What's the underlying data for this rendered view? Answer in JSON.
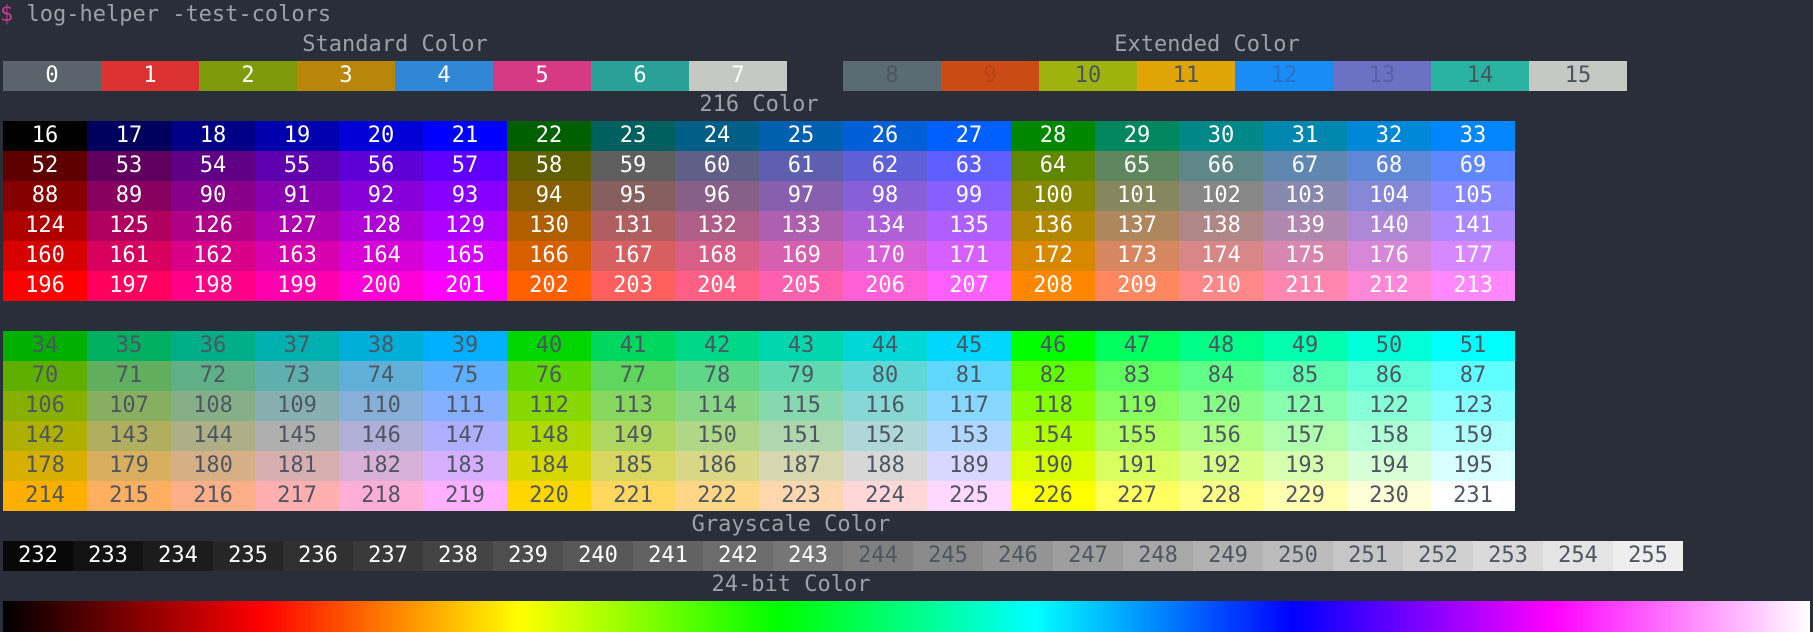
{
  "terminal": {
    "prompt_symbol": "$",
    "command": "log-helper -test-colors"
  },
  "titles": {
    "standard": "Standard Color",
    "extended": "Extended Color",
    "c216": "216 Color",
    "grayscale": "Grayscale Color",
    "truecolor": "24-bit Color"
  },
  "standard_colors": [
    {
      "label": "0",
      "bg": "#5b636c",
      "fg": "#ffffff"
    },
    {
      "label": "1",
      "bg": "#dc3232",
      "fg": "#ffffff"
    },
    {
      "label": "2",
      "bg": "#7f9a0a",
      "fg": "#ffffff"
    },
    {
      "label": "3",
      "bg": "#b8860b",
      "fg": "#ffffff"
    },
    {
      "label": "4",
      "bg": "#2f87d6",
      "fg": "#ffffff"
    },
    {
      "label": "5",
      "bg": "#d63a84",
      "fg": "#ffffff"
    },
    {
      "label": "6",
      "bg": "#2aa198",
      "fg": "#ffffff"
    },
    {
      "label": "7",
      "bg": "#c6c8c3",
      "fg": "#ffffff"
    }
  ],
  "extended_colors": [
    {
      "label": "8",
      "bg": "#5b6b74",
      "fg": "#4a5560"
    },
    {
      "label": "9",
      "bg": "#cb4b16",
      "fg": "#b84514"
    },
    {
      "label": "10",
      "bg": "#9fb30e",
      "fg": "#4a5560"
    },
    {
      "label": "11",
      "bg": "#e0a505",
      "fg": "#4a5560"
    },
    {
      "label": "12",
      "bg": "#1a8cf5",
      "fg": "#2a70c8"
    },
    {
      "label": "13",
      "bg": "#6c71c4",
      "fg": "#5b5fa8"
    },
    {
      "label": "14",
      "bg": "#2ab3a0",
      "fg": "#4a5560"
    },
    {
      "label": "15",
      "bg": "#c6c8c3",
      "fg": "#4a5560"
    }
  ],
  "palette216": {
    "block1_rows": [
      [
        "16",
        "17",
        "18",
        "19",
        "20",
        "21",
        "22",
        "23",
        "24",
        "25",
        "26",
        "27",
        "28",
        "29",
        "30",
        "31",
        "32",
        "33"
      ],
      [
        "52",
        "53",
        "54",
        "55",
        "56",
        "57",
        "58",
        "59",
        "60",
        "61",
        "62",
        "63",
        "64",
        "65",
        "66",
        "67",
        "68",
        "69"
      ],
      [
        "88",
        "89",
        "90",
        "91",
        "92",
        "93",
        "94",
        "95",
        "96",
        "97",
        "98",
        "99",
        "100",
        "101",
        "102",
        "103",
        "104",
        "105"
      ],
      [
        "124",
        "125",
        "126",
        "127",
        "128",
        "129",
        "130",
        "131",
        "132",
        "133",
        "134",
        "135",
        "136",
        "137",
        "138",
        "139",
        "140",
        "141"
      ],
      [
        "160",
        "161",
        "162",
        "163",
        "164",
        "165",
        "166",
        "167",
        "168",
        "169",
        "170",
        "171",
        "172",
        "173",
        "174",
        "175",
        "176",
        "177"
      ],
      [
        "196",
        "197",
        "198",
        "199",
        "200",
        "201",
        "202",
        "203",
        "204",
        "205",
        "206",
        "207",
        "208",
        "209",
        "210",
        "211",
        "212",
        "213"
      ]
    ],
    "block2_rows": [
      [
        "34",
        "35",
        "36",
        "37",
        "38",
        "39",
        "40",
        "41",
        "42",
        "43",
        "44",
        "45",
        "46",
        "47",
        "48",
        "49",
        "50",
        "51"
      ],
      [
        "70",
        "71",
        "72",
        "73",
        "74",
        "75",
        "76",
        "77",
        "78",
        "79",
        "80",
        "81",
        "82",
        "83",
        "84",
        "85",
        "86",
        "87"
      ],
      [
        "106",
        "107",
        "108",
        "109",
        "110",
        "111",
        "112",
        "113",
        "114",
        "115",
        "116",
        "117",
        "118",
        "119",
        "120",
        "121",
        "122",
        "123"
      ],
      [
        "142",
        "143",
        "144",
        "145",
        "146",
        "147",
        "148",
        "149",
        "150",
        "151",
        "152",
        "153",
        "154",
        "155",
        "156",
        "157",
        "158",
        "159"
      ],
      [
        "178",
        "179",
        "180",
        "181",
        "182",
        "183",
        "184",
        "185",
        "186",
        "187",
        "188",
        "189",
        "190",
        "191",
        "192",
        "193",
        "194",
        "195"
      ],
      [
        "214",
        "215",
        "216",
        "217",
        "218",
        "219",
        "220",
        "221",
        "222",
        "223",
        "224",
        "225",
        "226",
        "227",
        "228",
        "229",
        "230",
        "231"
      ]
    ],
    "light_text_color": "#ffffff",
    "dark_text_color": "#4d5662"
  },
  "grayscale": [
    "232",
    "233",
    "234",
    "235",
    "236",
    "237",
    "238",
    "239",
    "240",
    "241",
    "242",
    "243",
    "244",
    "245",
    "246",
    "247",
    "248",
    "249",
    "250",
    "251",
    "252",
    "253",
    "254",
    "255"
  ],
  "colors": {
    "background": "#2a2e38",
    "text": "#9ba1a9",
    "prompt": "#c43c8c"
  }
}
